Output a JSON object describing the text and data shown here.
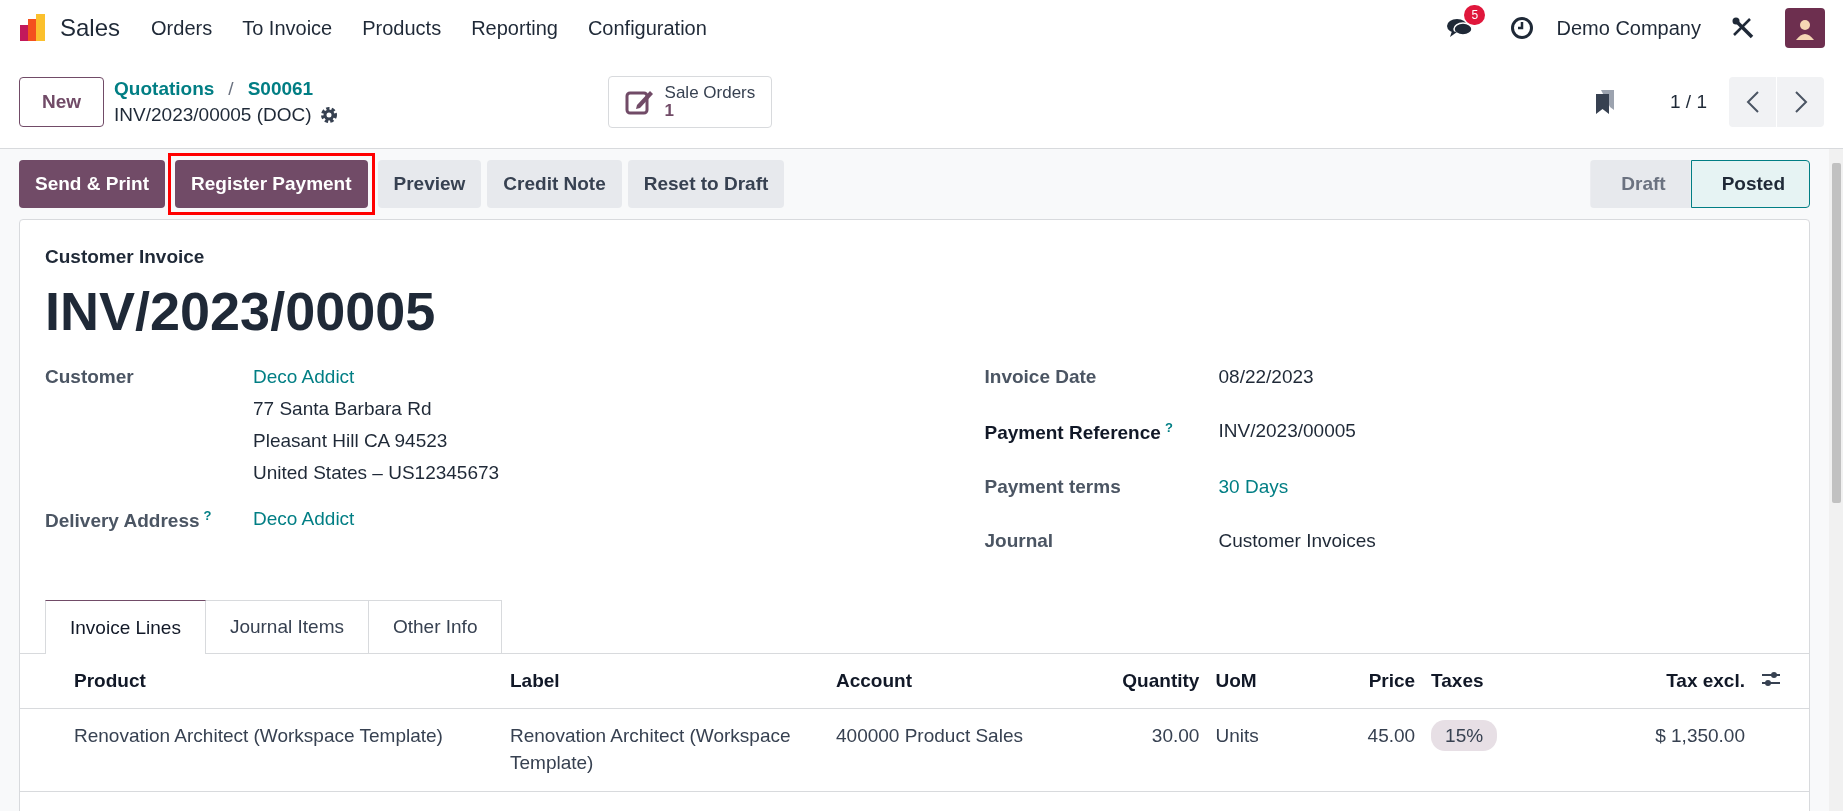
{
  "navbar": {
    "app": "Sales",
    "menu": [
      "Orders",
      "To Invoice",
      "Products",
      "Reporting",
      "Configuration"
    ],
    "messages_count": "5",
    "company": "Demo Company"
  },
  "control_panel": {
    "new_button": "New",
    "breadcrumbs": [
      "Quotations",
      "S00061"
    ],
    "breadcrumb_separator": "/",
    "record_name": "INV/2023/00005 (DOC)",
    "smart_button": {
      "label": "Sale Orders",
      "count": "1"
    },
    "pager": "1 / 1"
  },
  "actions": [
    {
      "label": "Send & Print",
      "kind": "primary",
      "highlighted": false
    },
    {
      "label": "Register Payment",
      "kind": "primary",
      "highlighted": true
    },
    {
      "label": "Preview",
      "kind": "secondary",
      "highlighted": false
    },
    {
      "label": "Credit Note",
      "kind": "secondary",
      "highlighted": false
    },
    {
      "label": "Reset to Draft",
      "kind": "secondary",
      "highlighted": false
    }
  ],
  "statusbar": [
    {
      "label": "Draft",
      "selected": false
    },
    {
      "label": "Posted",
      "selected": true
    }
  ],
  "form": {
    "type_label": "Customer Invoice",
    "number": "INV/2023/00005",
    "left_fields": [
      {
        "label": "Customer",
        "value": "Deco Addict",
        "link": true,
        "address": [
          "77 Santa Barbara Rd",
          "Pleasant Hill CA 94523",
          "United States – US12345673"
        ]
      },
      {
        "label": "Delivery Address",
        "value": "Deco Addict",
        "link": true,
        "help": "?"
      }
    ],
    "right_fields": [
      {
        "label": "Invoice Date",
        "value": "08/22/2023",
        "link": false,
        "bold": false
      },
      {
        "label": "Payment Reference",
        "value": "INV/2023/00005",
        "link": false,
        "help": "?",
        "bold": true
      },
      {
        "label": "Payment terms",
        "value": "30 Days",
        "link": true,
        "bold": false
      },
      {
        "label": "Journal",
        "value": "Customer Invoices",
        "link": false,
        "bold": false
      }
    ]
  },
  "tabs": [
    {
      "label": "Invoice Lines",
      "selected": true
    },
    {
      "label": "Journal Items",
      "selected": false
    },
    {
      "label": "Other Info",
      "selected": false
    }
  ],
  "table": {
    "columns": [
      "Product",
      "Label",
      "Account",
      "Quantity",
      "UoM",
      "Price",
      "Taxes",
      "Tax excl."
    ],
    "rows": [
      {
        "product": "Renovation Architect (Workspace Template)",
        "label": "Renovation Architect (Workspace Template)",
        "account": "400000 Product Sales",
        "quantity": "30.00",
        "uom": "Units",
        "price": "45.00",
        "taxes": "15%",
        "subtotal": "$ 1,350.00"
      }
    ]
  }
}
